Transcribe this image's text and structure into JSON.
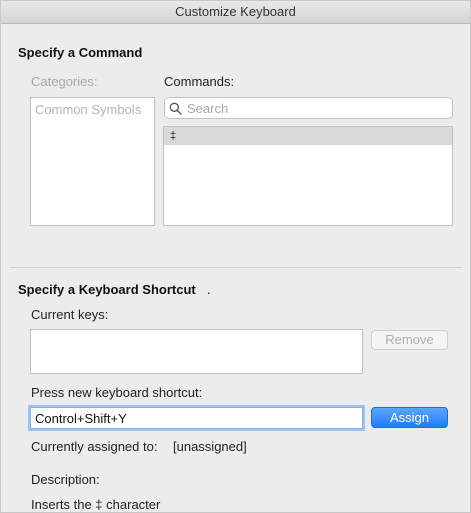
{
  "window": {
    "title": "Customize Keyboard"
  },
  "command_section": {
    "title": "Specify a Command",
    "categories_label": "Categories:",
    "categories": [
      "Common Symbols"
    ],
    "commands_label": "Commands:",
    "search_placeholder": "Search",
    "commands": [
      "‡"
    ]
  },
  "shortcut_section": {
    "title": "Specify a Keyboard Shortcut",
    "current_keys_label": "Current keys:",
    "remove_label": "Remove",
    "new_shortcut_label": "Press new keyboard shortcut:",
    "new_shortcut_value": "Control+Shift+Y",
    "assign_label": "Assign",
    "assigned_to_label": "Currently assigned to:",
    "assigned_to_value": "[unassigned]",
    "description_label": "Description:",
    "description_text": "Inserts the ‡ character"
  }
}
